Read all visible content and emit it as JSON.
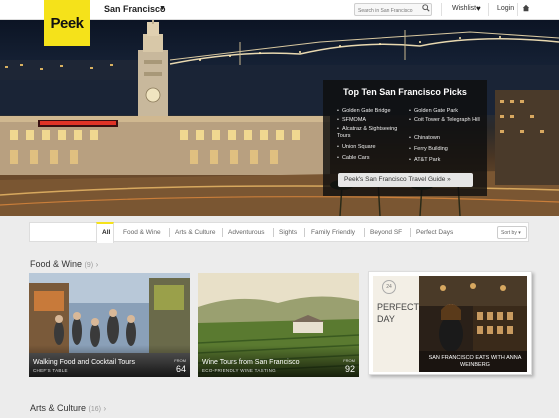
{
  "header": {
    "logo": "Peek",
    "city": "San Francisco",
    "search_placeholder": "Search in San Francisco",
    "wishlist": "Wishlist",
    "login": "Login"
  },
  "hero": {
    "picks_title": "Top Ten San Francisco Picks",
    "picks_left": [
      "Golden Gate Bridge",
      "SFMOMA",
      "Alcatraz & Sightseeing Tours",
      "Union Square",
      "Cable Cars"
    ],
    "picks_right": [
      "Golden Gate Park",
      "Coit Tower & Telegraph Hill",
      "Chinatown",
      "Ferry Building",
      "AT&T Park"
    ],
    "guide_button": "Peek's San Francisco Travel Guide »"
  },
  "filters": {
    "tabs": [
      "All",
      "Food & Wine",
      "Arts & Culture",
      "Adventurous",
      "Sights",
      "Family Friendly",
      "Beyond SF",
      "Perfect Days"
    ],
    "sort": "Sort by"
  },
  "sections": {
    "food": {
      "title": "Food & Wine",
      "count": "(9)"
    },
    "arts": {
      "title": "Arts & Culture",
      "count": "(16)"
    }
  },
  "cards": [
    {
      "title": "Walking Food and Cocktail Tours",
      "sub": "CHEF'S TABLE",
      "from": "FROM",
      "price": "64"
    },
    {
      "title": "Wine Tours from San Francisco",
      "sub": "ECO-FRIENDLY WINE TASTING",
      "from": "FROM",
      "price": "92"
    }
  ],
  "perfect_day": {
    "number": "24",
    "word1": "PERFECT",
    "word2": "DAY",
    "caption": "SAN FRANCISCO EATS WITH ANNA WEINBERG"
  },
  "colors": {
    "brand_yellow": "#f5e21a"
  }
}
